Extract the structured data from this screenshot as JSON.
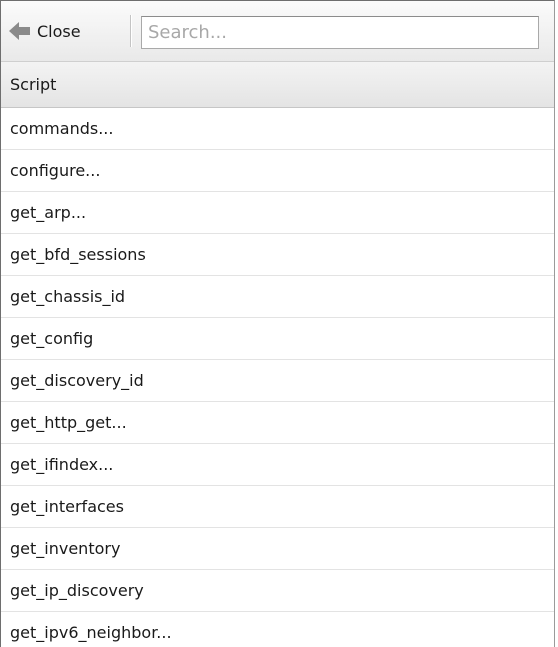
{
  "toolbar": {
    "close_label": "Close",
    "close_icon": "arrow-left-icon",
    "search_placeholder": "Search...",
    "search_value": ""
  },
  "grid": {
    "column_header": "Script",
    "rows": [
      "commands...",
      "configure...",
      "get_arp...",
      "get_bfd_sessions",
      "get_chassis_id",
      "get_config",
      "get_discovery_id",
      "get_http_get...",
      "get_ifindex...",
      "get_interfaces",
      "get_inventory",
      "get_ip_discovery",
      "get_ipv6_neighbor..."
    ]
  },
  "colors": {
    "icon_gray": "#8a8a8a",
    "placeholder": "#a8a8a8"
  }
}
